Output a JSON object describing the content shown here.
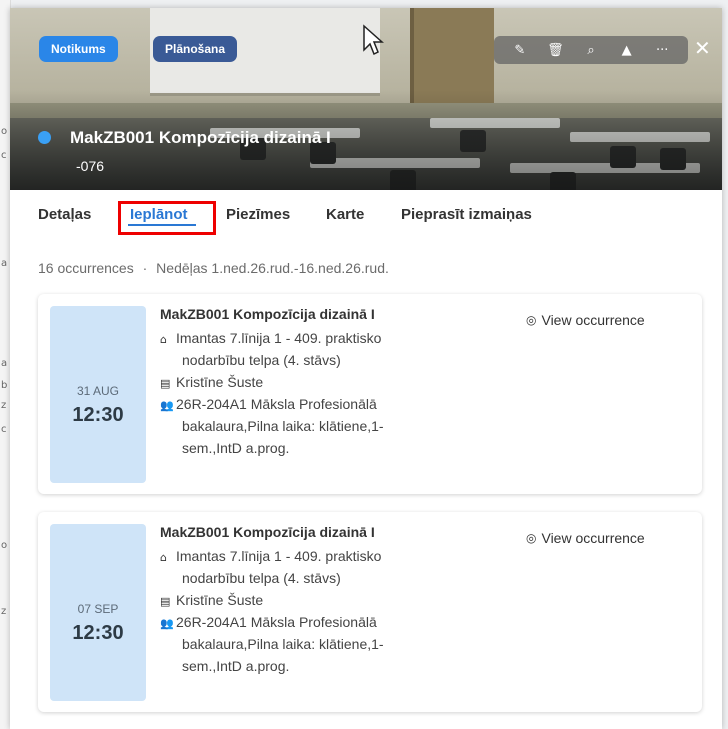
{
  "header": {
    "badges": [
      "Notikums",
      "Plānošana"
    ],
    "title": "MakZB001 Kompozīcija dizainā I",
    "subtitle": "-076",
    "toolbar_icons": [
      "pencil-icon",
      "trash-icon",
      "search-icon",
      "alert-icon",
      "more-icon"
    ],
    "close_icon": "close-icon"
  },
  "tabs": [
    "Detaļas",
    "Ieplānot",
    "Piezīmes",
    "Karte",
    "Pieprasīt izmaiņas"
  ],
  "active_tab": "Ieplānot",
  "summary": {
    "count": "16 occurrences",
    "separator": "·",
    "weeks": "Nedēļas 1.ned.26.rud.-16.ned.26.rud."
  },
  "occurrences": [
    {
      "date": "31 AUG",
      "time": "12:30",
      "title": "MakZB001 Kompozīcija dizainā I",
      "location_1": "Imantas 7.līnija 1 - 409. praktisko",
      "location_2": "nodarbību telpa (4. stāvs)",
      "teacher": "Kristīne Šuste",
      "group_1": "26R-204A1 Māksla Profesionālā",
      "group_2": "bakalaura,Pilna laika: klātiene,1-",
      "group_3": "sem.,IntD a.prog.",
      "view_label": "View occurrence"
    },
    {
      "date": "07 SEP",
      "time": "12:30",
      "title": "MakZB001 Kompozīcija dizainā I",
      "location_1": "Imantas 7.līnija 1 - 409. praktisko",
      "location_2": "nodarbību telpa (4. stāvs)",
      "teacher": "Kristīne Šuste",
      "group_1": "26R-204A1 Māksla Profesionālā",
      "group_2": "bakalaura,Pilna laika: klātiene,1-",
      "group_3": "sem.,IntD a.prog.",
      "view_label": "View occurrence"
    }
  ],
  "colors": {
    "accent": "#2a78d4",
    "badge_blue": "#2a86e8",
    "badge_navy": "#3a5a96",
    "date_bg": "#cfe4f8",
    "highlight": "#e00000"
  }
}
